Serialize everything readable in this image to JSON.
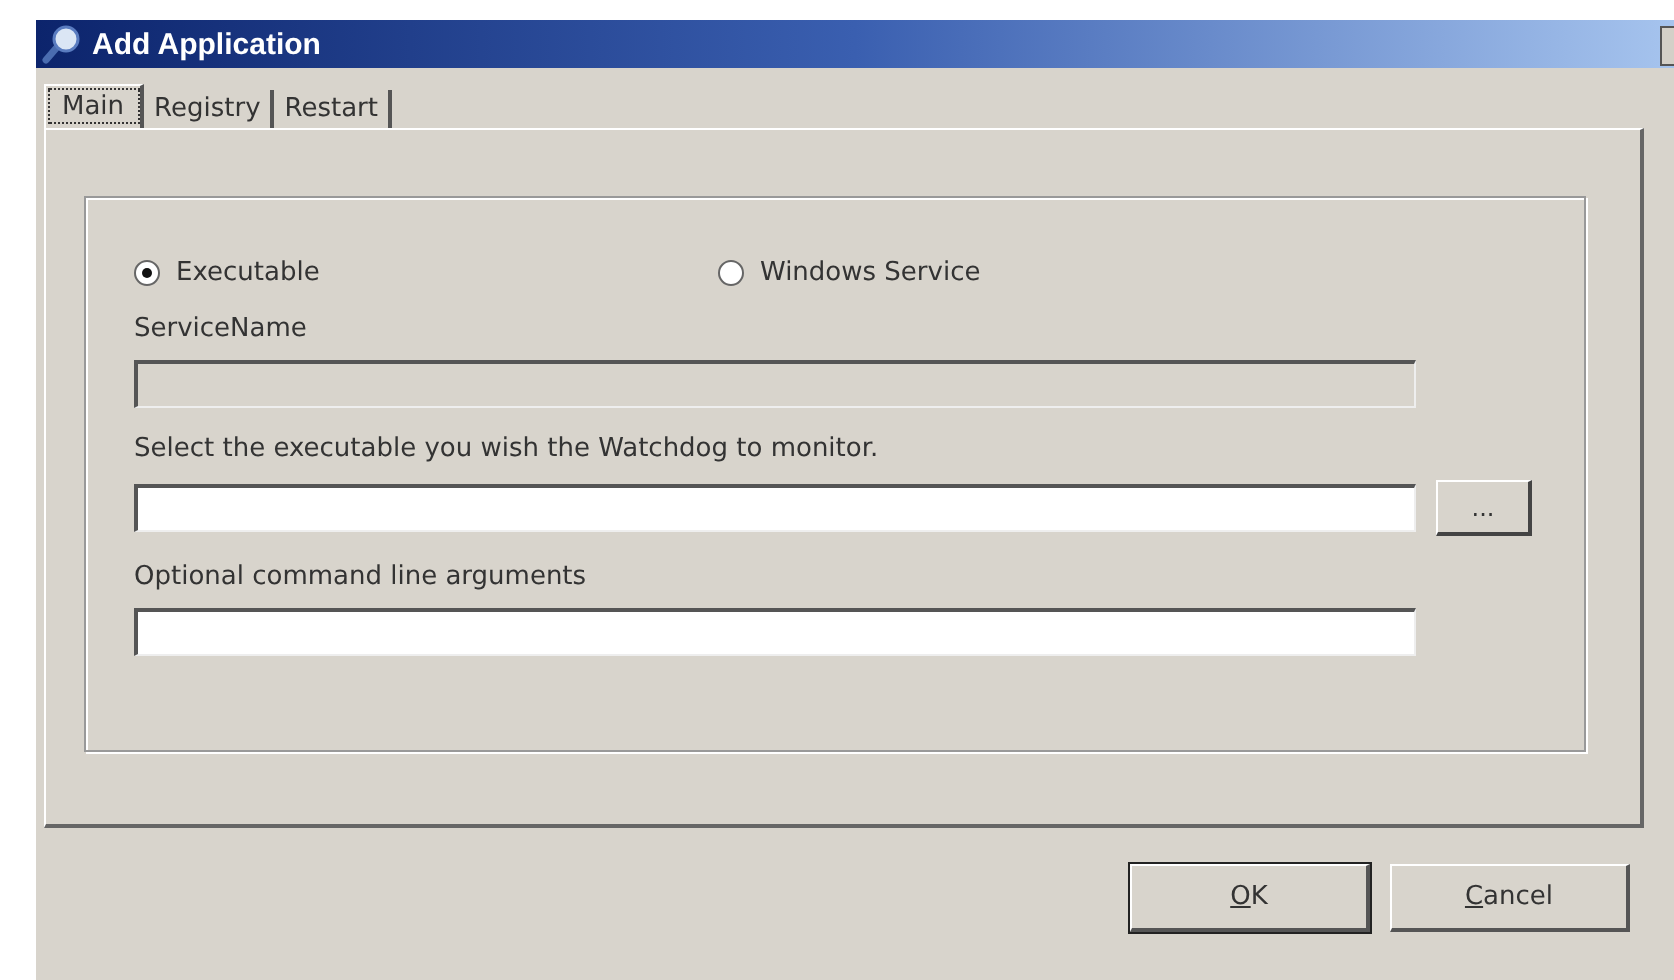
{
  "window": {
    "title": "Add Application"
  },
  "tabs": [
    {
      "label": "Main",
      "selected": true
    },
    {
      "label": "Registry",
      "selected": false
    },
    {
      "label": "Restart",
      "selected": false
    }
  ],
  "mode_options": [
    {
      "label": "Executable",
      "selected": true
    },
    {
      "label": "Windows Service",
      "selected": false
    }
  ],
  "fields": [
    {
      "label": "ServiceName",
      "disabled": true,
      "browse": false
    },
    {
      "label": "Select the executable you wish the Watchdog to monitor.",
      "disabled": false,
      "browse": true,
      "browse_label": "..."
    },
    {
      "label": "Optional command line arguments",
      "disabled": false,
      "browse": false
    }
  ],
  "buttons": [
    {
      "label": "OK",
      "default": true
    },
    {
      "label": "Cancel",
      "default": false
    }
  ]
}
